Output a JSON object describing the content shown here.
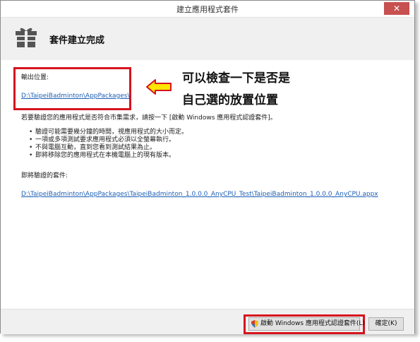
{
  "window": {
    "title": "建立應用程式套件",
    "close_label": "✕"
  },
  "header": {
    "title": "套件建立完成",
    "icon": "gift-icon"
  },
  "output": {
    "label": "輸出位置:",
    "path": "D:\\TaipeiBadminton\\AppPackages\\"
  },
  "annotation": {
    "line1": "可以檢查一下是否是",
    "line2": "自己選的放置位置"
  },
  "intro": "若要驗證您的應用程式是否符合市集需求，請按一下 [啟動 Windows 應用程式認證套件]。",
  "bullets": [
    "驗證可能需要幾分鐘的時間，視應用程式的大小而定。",
    "一項或多項測試要求應用程式必須以全螢幕執行。",
    "不與電腦互動，直到您看到測試結果為止。",
    "即將移除您的應用程式在本機電腦上的現有版本。"
  ],
  "package": {
    "label": "即將驗證的套件:",
    "path": "D:\\TaipeiBadminton\\AppPackages\\TaipeiBadminton_1.0.0.0_AnyCPU_Test\\TaipeiBadminton_1.0.0.0_AnyCPU.appx"
  },
  "footer": {
    "launch_label": "啟動 Windows 應用程式認證套件(L)",
    "ok_label": "確定(K)"
  },
  "colors": {
    "highlight": "#d6141f",
    "link": "#1d5fb5",
    "arrow_fill": "#ffe600"
  }
}
